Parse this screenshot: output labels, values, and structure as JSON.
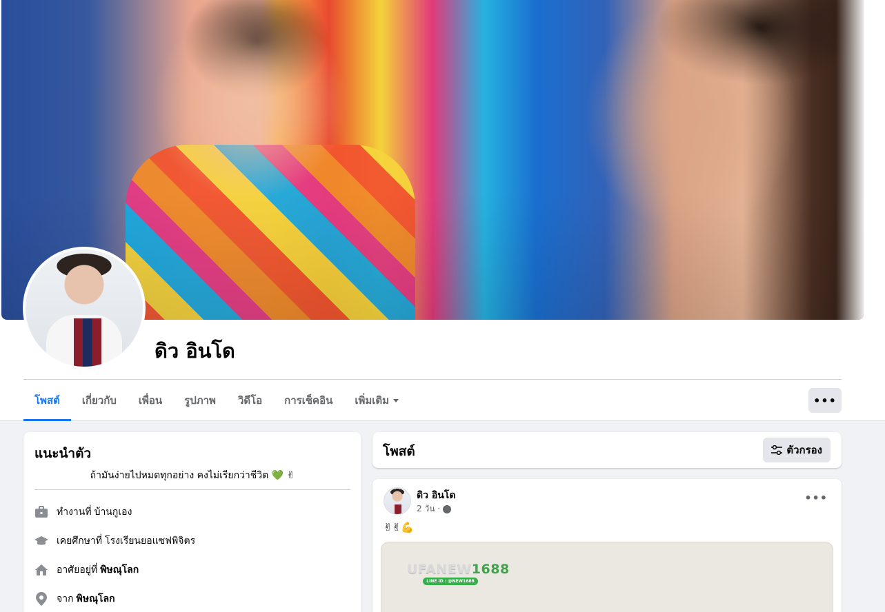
{
  "profile": {
    "name": "ดิว อินโด"
  },
  "tabs": [
    {
      "label": "โพสต์",
      "active": true
    },
    {
      "label": "เกี่ยวกับ",
      "active": false
    },
    {
      "label": "เพื่อน",
      "active": false
    },
    {
      "label": "รูปภาพ",
      "active": false
    },
    {
      "label": "วิดีโอ",
      "active": false
    },
    {
      "label": "การเช็คอิน",
      "active": false
    },
    {
      "label": "เพิ่มเติม",
      "active": false
    }
  ],
  "more_menu": "•••",
  "intro": {
    "title": "แนะนำตัว",
    "bio": "ถ้ามันง่ายไปหมดทุกอย่าง คงไม่เรียกว่าชีวิต",
    "bio_emojis": [
      "💚",
      "✌"
    ],
    "work": {
      "prefix": "ทำงานที่",
      "value": "บ้านกูเอง",
      "icon": "briefcase-icon"
    },
    "education": {
      "prefix": "เคยศึกษาที่",
      "value": "โรงเรียนยอแซฟพิจิตร",
      "icon": "graduation-cap-icon"
    },
    "lives": {
      "prefix": "อาศัยอยู่ที่",
      "value": "พิษณุโลก",
      "icon": "home-icon"
    },
    "from": {
      "prefix": "จาก",
      "value": "พิษณุโลก",
      "icon": "location-pin-icon"
    }
  },
  "posts_header": {
    "title": "โพสต์",
    "filter_label": "ตัวกรอง"
  },
  "post": {
    "author": "ดิว อินโด",
    "time": "2 วัน ·",
    "privacy_icon": "globe-icon",
    "text": "✌✌💪",
    "media_brand_part1": "UFANEW",
    "media_brand_part2": "1688",
    "media_line_badge": "LINE ID : @NEW1688",
    "more": "•••"
  },
  "colors": {
    "accent": "#1877f2",
    "page_bg": "#f0f2f5",
    "secondary_text": "#65676b"
  }
}
